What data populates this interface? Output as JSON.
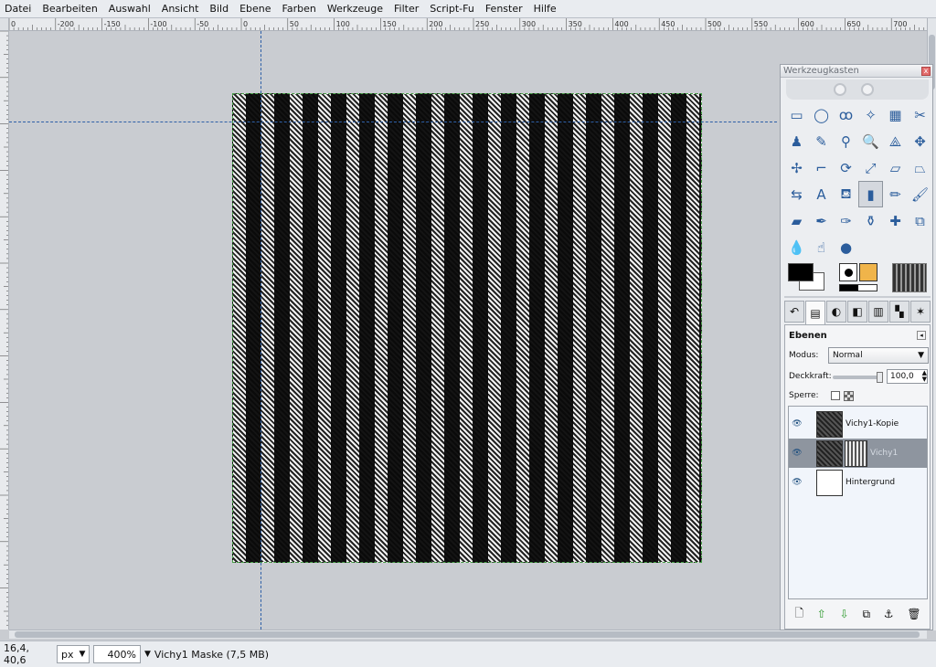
{
  "menu": [
    "Datei",
    "Bearbeiten",
    "Auswahl",
    "Ansicht",
    "Bild",
    "Ebene",
    "Farben",
    "Werkzeuge",
    "Filter",
    "Script-Fu",
    "Fenster",
    "Hilfe"
  ],
  "ruler_labels": [
    "0",
    "-200",
    "-150",
    "-100",
    "-50",
    "0",
    "50",
    "100",
    "150",
    "200",
    "250",
    "300",
    "350",
    "400",
    "450",
    "500",
    "550",
    "600",
    "650",
    "700"
  ],
  "status": {
    "coords": "16,4, 40,6",
    "unit": "px",
    "zoom": "400%",
    "info": "Vichy1 Maske (7,5 MB)"
  },
  "toolbox": {
    "title": "Werkzeugkasten",
    "close": "x"
  },
  "tools": [
    {
      "name": "rect-select-icon",
      "glyph": "▭"
    },
    {
      "name": "ellipse-select-icon",
      "glyph": "◯"
    },
    {
      "name": "free-select-icon",
      "glyph": "ꝏ"
    },
    {
      "name": "fuzzy-select-icon",
      "glyph": "✧"
    },
    {
      "name": "color-select-icon",
      "glyph": "▦"
    },
    {
      "name": "scissors-icon",
      "glyph": "✂"
    },
    {
      "name": "foreground-select-icon",
      "glyph": "♟"
    },
    {
      "name": "paths-icon",
      "glyph": "✎"
    },
    {
      "name": "color-picker-icon",
      "glyph": "⚲"
    },
    {
      "name": "zoom-icon",
      "glyph": "🔍"
    },
    {
      "name": "measure-icon",
      "glyph": "⟁"
    },
    {
      "name": "move-icon",
      "glyph": "✥"
    },
    {
      "name": "align-icon",
      "glyph": "✢"
    },
    {
      "name": "crop-icon",
      "glyph": "⌐"
    },
    {
      "name": "rotate-icon",
      "glyph": "⟳"
    },
    {
      "name": "scale-icon",
      "glyph": "⤢"
    },
    {
      "name": "shear-icon",
      "glyph": "▱"
    },
    {
      "name": "perspective-icon",
      "glyph": "⏢"
    },
    {
      "name": "flip-icon",
      "glyph": "⇆"
    },
    {
      "name": "text-icon",
      "glyph": "A"
    },
    {
      "name": "bucket-fill-icon",
      "glyph": "⛾"
    },
    {
      "name": "blend-icon",
      "glyph": "▮"
    },
    {
      "name": "pencil-icon",
      "glyph": "✏"
    },
    {
      "name": "paintbrush-icon",
      "glyph": "🖌"
    },
    {
      "name": "eraser-icon",
      "glyph": "▰"
    },
    {
      "name": "airbrush-icon",
      "glyph": "✒"
    },
    {
      "name": "ink-icon",
      "glyph": "✑"
    },
    {
      "name": "clone-icon",
      "glyph": "⚱"
    },
    {
      "name": "heal-icon",
      "glyph": "✚"
    },
    {
      "name": "perspective-clone-icon",
      "glyph": "⧉"
    },
    {
      "name": "blur-icon",
      "glyph": "💧"
    },
    {
      "name": "smudge-icon",
      "glyph": "☝"
    },
    {
      "name": "dodge-burn-icon",
      "glyph": "●"
    }
  ],
  "selected_tool_index": 21,
  "dock_tabs": [
    {
      "name": "undo-history-icon",
      "glyph": "↶"
    },
    {
      "name": "layers-tab-icon",
      "glyph": "▤"
    },
    {
      "name": "channels-tab-icon",
      "glyph": "◐"
    },
    {
      "name": "paths-tab-icon",
      "glyph": "◧"
    },
    {
      "name": "gradients-tab-icon",
      "glyph": "▥"
    },
    {
      "name": "palettes-tab-icon",
      "glyph": "▚"
    },
    {
      "name": "fonts-tab-icon",
      "glyph": "✶"
    }
  ],
  "layers": {
    "title": "Ebenen",
    "mode_label": "Modus:",
    "mode_value": "Normal",
    "opacity_label": "Deckkraft:",
    "opacity_value": "100,0",
    "lock_label": "Sperre:",
    "items": [
      {
        "name": "Vichy1-Kopie",
        "selected": false,
        "thumb": "pattern",
        "mask": false
      },
      {
        "name": "Vichy1",
        "selected": true,
        "thumb": "pattern",
        "mask": true
      },
      {
        "name": "Hintergrund",
        "selected": false,
        "thumb": "white",
        "mask": false
      }
    ],
    "buttons": [
      {
        "name": "new-layer-icon",
        "glyph": "🗋"
      },
      {
        "name": "raise-layer-icon",
        "glyph": "⇧",
        "color": "#2e9b2e"
      },
      {
        "name": "lower-layer-icon",
        "glyph": "⇩",
        "color": "#2e9b2e"
      },
      {
        "name": "duplicate-layer-icon",
        "glyph": "⧉"
      },
      {
        "name": "anchor-layer-icon",
        "glyph": "⚓"
      },
      {
        "name": "delete-layer-icon",
        "glyph": "🗑"
      }
    ]
  }
}
